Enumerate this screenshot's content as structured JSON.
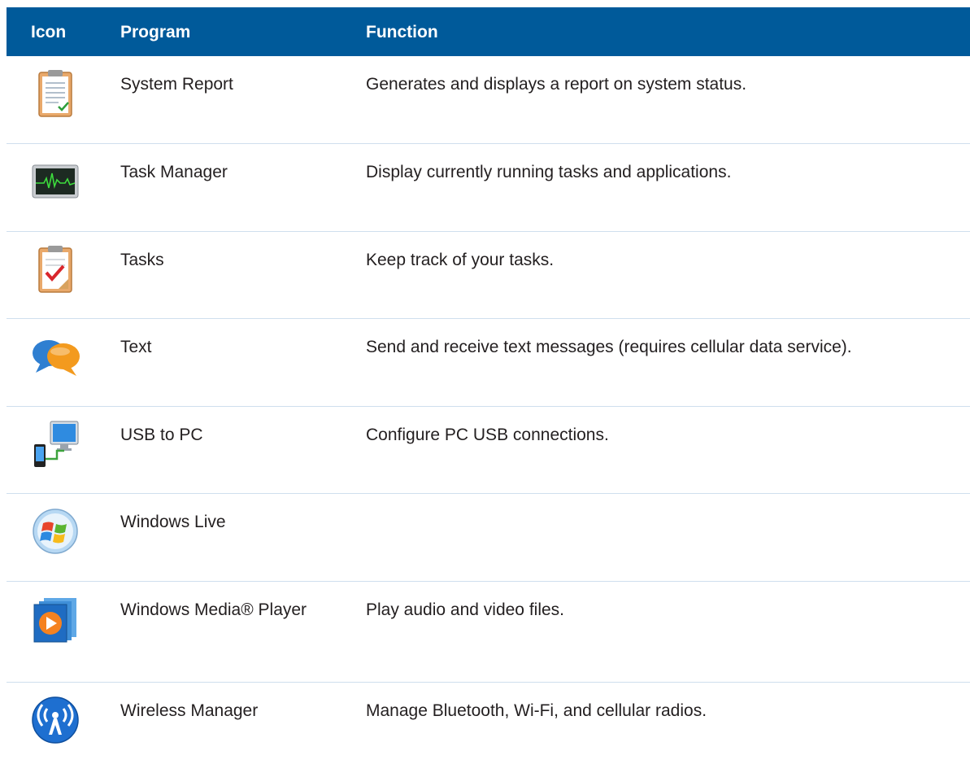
{
  "header": {
    "icon": "Icon",
    "program": "Program",
    "function": "Function"
  },
  "rows": [
    {
      "icon": "system-report-icon",
      "program": "System Report",
      "function": "Generates and displays a report on system status."
    },
    {
      "icon": "task-manager-icon",
      "program": "Task Manager",
      "function": "Display currently running tasks and applications."
    },
    {
      "icon": "tasks-icon",
      "program": "Tasks",
      "function": "Keep track of your tasks."
    },
    {
      "icon": "text-messages-icon",
      "program": "Text",
      "function": "Send and receive text messages (requires cellular data service)."
    },
    {
      "icon": "usb-to-pc-icon",
      "program": "USB to PC",
      "function": "Configure PC USB connections."
    },
    {
      "icon": "windows-live-icon",
      "program": "Windows Live",
      "function": ""
    },
    {
      "icon": "windows-media-player-icon",
      "program": "Windows Media® Player",
      "function": "Play audio and video files."
    },
    {
      "icon": "wireless-manager-icon",
      "program": "Wireless Manager",
      "function": "Manage Bluetooth, Wi-Fi, and cellular radios."
    }
  ],
  "colors": {
    "header_bg": "#005a9a",
    "header_text": "#ffffff",
    "row_divider": "#cfdfee",
    "body_text": "#231f20"
  }
}
